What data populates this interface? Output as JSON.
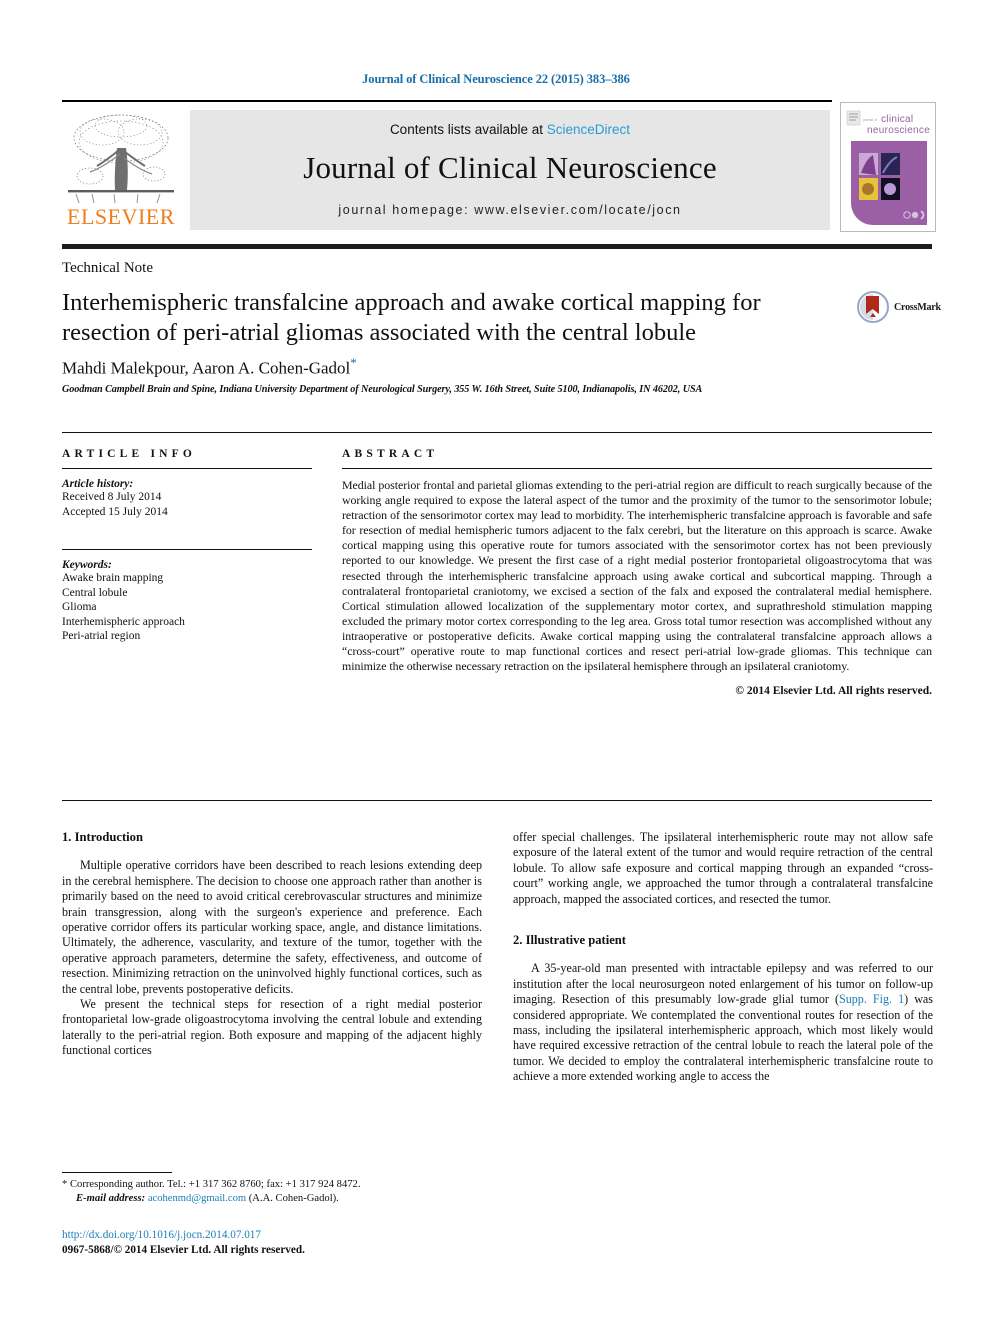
{
  "running_head": "Journal of Clinical Neuroscience 22 (2015) 383–386",
  "masthead": {
    "contents_prefix": "Contents lists available at ",
    "sciencedirect": "ScienceDirect",
    "journal_title": "Journal of Clinical Neuroscience",
    "homepage": "journal homepage: www.elsevier.com/locate/jocn",
    "publisher": "ELSEVIER",
    "cover_title_line1": "clinical",
    "cover_title_line2": "neuroscience"
  },
  "article": {
    "type": "Technical Note",
    "title": "Interhemispheric transfalcine approach and awake cortical mapping for resection of peri-atrial gliomas associated with the central lobule",
    "authors": "Mahdi Malekpour, Aaron A. Cohen-Gadol",
    "corresponding_marker": "*",
    "affiliation": "Goodman Campbell Brain and Spine, Indiana University Department of Neurological Surgery, 355 W. 16th Street, Suite 5100, Indianapolis, IN 46202, USA",
    "crossmark_label": "CrossMark"
  },
  "article_info": {
    "heading": "ARTICLE INFO",
    "history_label": "Article history:",
    "received": "Received 8 July 2014",
    "accepted": "Accepted 15 July 2014",
    "keywords_label": "Keywords:",
    "keywords": [
      "Awake brain mapping",
      "Central lobule",
      "Glioma",
      "Interhemispheric approach",
      "Peri-atrial region"
    ]
  },
  "abstract": {
    "heading": "ABSTRACT",
    "text": "Medial posterior frontal and parietal gliomas extending to the peri-atrial region are difficult to reach surgically because of the working angle required to expose the lateral aspect of the tumor and the proximity of the tumor to the sensorimotor lobule; retraction of the sensorimotor cortex may lead to morbidity. The interhemispheric transfalcine approach is favorable and safe for resection of medial hemispheric tumors adjacent to the falx cerebri, but the literature on this approach is scarce. Awake cortical mapping using this operative route for tumors associated with the sensorimotor cortex has not been previously reported to our knowledge. We present the first case of a right medial posterior frontoparietal oligoastrocytoma that was resected through the interhemispheric transfalcine approach using awake cortical and subcortical mapping. Through a contralateral frontoparietal craniotomy, we excised a section of the falx and exposed the contralateral medial hemisphere. Cortical stimulation allowed localization of the supplementary motor cortex, and suprathreshold stimulation mapping excluded the primary motor cortex corresponding to the leg area. Gross total tumor resection was accomplished without any intraoperative or postoperative deficits. Awake cortical mapping using the contralateral transfalcine approach allows a “cross-court” operative route to map functional cortices and resect peri-atrial low-grade gliomas. This technique can minimize the otherwise necessary retraction on the ipsilateral hemisphere through an ipsilateral craniotomy.",
    "copyright": "© 2014 Elsevier Ltd. All rights reserved."
  },
  "body": {
    "section1_title": "1. Introduction",
    "section1_para1": "Multiple operative corridors have been described to reach lesions extending deep in the cerebral hemisphere. The decision to choose one approach rather than another is primarily based on the need to avoid critical cerebrovascular structures and minimize brain transgression, along with the surgeon's experience and preference. Each operative corridor offers its particular working space, angle, and distance limitations. Ultimately, the adherence, vascularity, and texture of the tumor, together with the operative approach parameters, determine the safety, effectiveness, and outcome of resection. Minimizing retraction on the uninvolved highly functional cortices, such as the central lobe, prevents postoperative deficits.",
    "section1_para2": "We present the technical steps for resection of a right medial posterior frontoparietal low-grade oligoastrocytoma involving the central lobule and extending laterally to the peri-atrial region. Both exposure and mapping of the adjacent highly functional cortices",
    "section1_para2_cont": "offer special challenges. The ipsilateral interhemispheric route may not allow safe exposure of the lateral extent of the tumor and would require retraction of the central lobule. To allow safe exposure and cortical mapping through an expanded “cross-court” working angle, we approached the tumor through a contralateral transfalcine approach, mapped the associated cortices, and resected the tumor.",
    "section2_title": "2. Illustrative patient",
    "section2_para1_a": "A 35-year-old man presented with intractable epilepsy and was referred to our institution after the local neurosurgeon noted enlargement of his tumor on follow-up imaging. Resection of this presumably low-grade glial tumor (",
    "section2_link": "Supp. Fig. 1",
    "section2_para1_b": ") was considered appropriate. We contemplated the conventional routes for resection of the mass, including the ipsilateral interhemispheric approach, which most likely would have required excessive retraction of the central lobule to reach the lateral pole of the tumor. We decided to employ the contralateral interhemispheric transfalcine route to achieve a more extended working angle to access the"
  },
  "footnote": {
    "marker": "*",
    "corresponding": "Corresponding author. Tel.: +1 317 362 8760; fax: +1 317 924 8472.",
    "email_label": "E-mail address:",
    "email": "acohenmd@gmail.com",
    "email_suffix": "(A.A. Cohen-Gadol).",
    "doi": "http://dx.doi.org/10.1016/j.jocn.2014.07.017",
    "issn": "0967-5868/© 2014 Elsevier Ltd. All rights reserved."
  },
  "colors": {
    "link_blue": "#1a7fb5",
    "header_blue": "#1a6ea8",
    "sciencedirect_blue": "#2b9ad3",
    "elsevier_orange": "#ef7d1a",
    "band_grey": "#e6e6e6",
    "cover_purple": "#9b5fa5"
  }
}
